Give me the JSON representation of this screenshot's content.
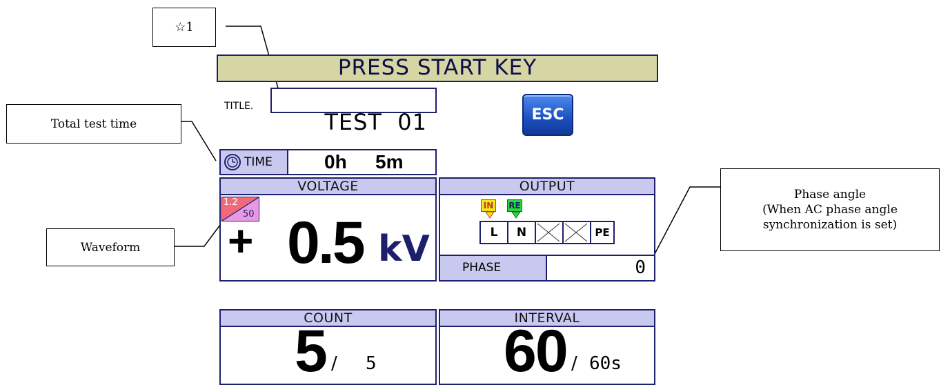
{
  "annotations": {
    "star_note": "☆1",
    "total_test_time": "Total test time",
    "waveform": "Waveform",
    "phase_angle_line1": "Phase angle",
    "phase_angle_line2": "(When AC phase angle",
    "phase_angle_line3": "synchronization is set)"
  },
  "status_banner": "PRESS START KEY",
  "title_label": "TITLE.",
  "title_value": "TEST  01",
  "esc_label": "ESC",
  "time": {
    "label": "TIME",
    "hours": "0h",
    "minutes": "5m"
  },
  "voltage": {
    "header": "VOLTAGE",
    "waveform_top": "1.2",
    "waveform_bottom": "50",
    "sign": "+",
    "value": "0.5",
    "unit": "kV"
  },
  "output": {
    "header": "OUTPUT",
    "in_tag": "IN",
    "re_tag": "RE",
    "terminals": [
      "L",
      "N",
      "",
      "",
      "PE"
    ],
    "phase_label": "PHASE",
    "phase_value": "0"
  },
  "count": {
    "header": "COUNT",
    "current": "5",
    "separator": "/",
    "total": "5"
  },
  "interval": {
    "header": "INTERVAL",
    "current": "60",
    "separator": "/",
    "total": "60s"
  },
  "colors": {
    "banner_bg": "#d6d6a4",
    "header_bg": "#c9c9f0",
    "border": "#1e1e6e",
    "esc_blue": "#1f5bd0",
    "in_tag": "#f3e51a",
    "re_tag": "#27d93a",
    "wave_red": "#f26a7a",
    "wave_pink": "#e79ae4"
  }
}
